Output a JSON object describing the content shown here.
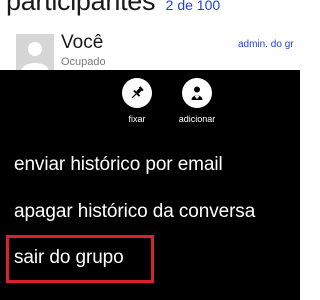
{
  "header": {
    "title": "participantes",
    "count": "2 de 100"
  },
  "contact": {
    "name": "Você",
    "status": "Ocupado",
    "role": "admin. do gr"
  },
  "menu": {
    "actions": [
      {
        "label": "fixar",
        "icon": "pin-icon"
      },
      {
        "label": "adicionar",
        "icon": "add-person-icon"
      }
    ],
    "items": [
      {
        "label": "enviar histórico por email"
      },
      {
        "label": "apagar histórico da conversa"
      },
      {
        "label": "sair do grupo",
        "highlighted": true
      }
    ]
  },
  "colors": {
    "accent": "#1f3fd8",
    "menu_background": "#000000",
    "highlight": "#d9232a"
  }
}
